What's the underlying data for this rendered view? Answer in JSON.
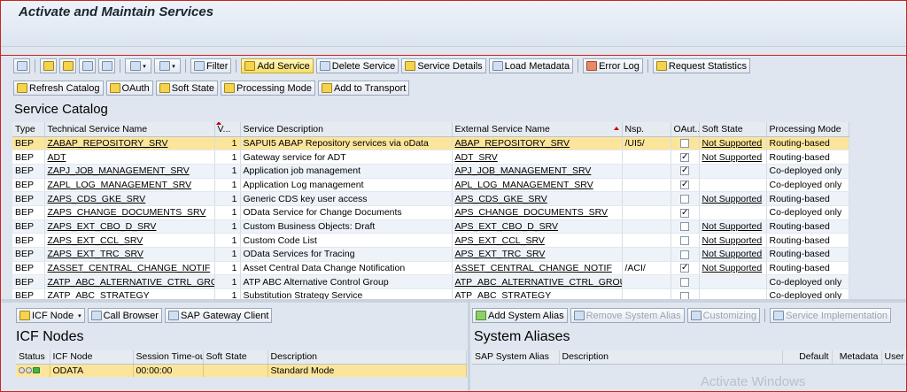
{
  "window": {
    "title": "Activate and Maintain Services"
  },
  "toolbar1": {
    "filter": "Filter",
    "add_service": "Add Service",
    "delete_service": "Delete Service",
    "service_details": "Service Details",
    "load_metadata": "Load Metadata",
    "error_log": "Error Log",
    "request_statistics": "Request Statistics"
  },
  "toolbar2": {
    "refresh_catalog": "Refresh Catalog",
    "oauth": "OAuth",
    "soft_state": "Soft State",
    "processing_mode": "Processing Mode",
    "add_to_transport": "Add to Transport"
  },
  "catalog": {
    "heading": "Service Catalog",
    "columns": [
      "Type",
      "Technical Service Name",
      "V...",
      "Service Description",
      "External Service Name",
      "Nsp.",
      "OAut...",
      "Soft State",
      "Processing Mode"
    ],
    "rows": [
      {
        "type": "BEP",
        "tech": "ZABAP_REPOSITORY_SRV",
        "ver": "1",
        "desc": "SAPUI5 ABAP Repository services via oData",
        "ext": "ABAP_REPOSITORY_SRV",
        "nsp": "/UI5/",
        "oauth": false,
        "soft": "Not Supported",
        "mode": "Routing-based"
      },
      {
        "type": "BEP",
        "tech": "ADT",
        "ver": "1",
        "desc": "Gateway service for ADT",
        "ext": "ADT_SRV",
        "nsp": "",
        "oauth": true,
        "soft": "Not Supported",
        "mode": "Routing-based"
      },
      {
        "type": "BEP",
        "tech": "ZAPJ_JOB_MANAGEMENT_SRV",
        "ver": "1",
        "desc": "Application job management",
        "ext": "APJ_JOB_MANAGEMENT_SRV",
        "nsp": "",
        "oauth": true,
        "soft": "",
        "mode": "Co-deployed only"
      },
      {
        "type": "BEP",
        "tech": "ZAPL_LOG_MANAGEMENT_SRV",
        "ver": "1",
        "desc": "Application Log management",
        "ext": "APL_LOG_MANAGEMENT_SRV",
        "nsp": "",
        "oauth": true,
        "soft": "",
        "mode": "Co-deployed only"
      },
      {
        "type": "BEP",
        "tech": "ZAPS_CDS_GKE_SRV",
        "ver": "1",
        "desc": "Generic CDS key user access",
        "ext": "APS_CDS_GKE_SRV",
        "nsp": "",
        "oauth": false,
        "soft": "Not Supported",
        "mode": "Routing-based"
      },
      {
        "type": "BEP",
        "tech": "ZAPS_CHANGE_DOCUMENTS_SRV",
        "ver": "1",
        "desc": "OData Service for Change Documents",
        "ext": "APS_CHANGE_DOCUMENTS_SRV",
        "nsp": "",
        "oauth": true,
        "soft": "",
        "mode": "Co-deployed only"
      },
      {
        "type": "BEP",
        "tech": "ZAPS_EXT_CBO_D_SRV",
        "ver": "1",
        "desc": "Custom Business Objects: Draft",
        "ext": "APS_EXT_CBO_D_SRV",
        "nsp": "",
        "oauth": false,
        "soft": "Not Supported",
        "mode": "Routing-based"
      },
      {
        "type": "BEP",
        "tech": "ZAPS_EXT_CCL_SRV",
        "ver": "1",
        "desc": "Custom Code List",
        "ext": "APS_EXT_CCL_SRV",
        "nsp": "",
        "oauth": false,
        "soft": "Not Supported",
        "mode": "Routing-based"
      },
      {
        "type": "BEP",
        "tech": "ZAPS_EXT_TRC_SRV",
        "ver": "1",
        "desc": "OData Services for Tracing",
        "ext": "APS_EXT_TRC_SRV",
        "nsp": "",
        "oauth": false,
        "soft": "Not Supported",
        "mode": "Routing-based"
      },
      {
        "type": "BEP",
        "tech": "ZASSET_CENTRAL_CHANGE_NOTIF",
        "ver": "1",
        "desc": "Asset Central Data Change Notification",
        "ext": "ASSET_CENTRAL_CHANGE_NOTIF",
        "nsp": "/ACI/",
        "oauth": true,
        "soft": "Not Supported",
        "mode": "Routing-based"
      },
      {
        "type": "BEP",
        "tech": "ZATP_ABC_ALTERNATIVE_CTRL_GROUP",
        "ver": "1",
        "desc": "ATP ABC Alternative Control Group",
        "ext": "ATP_ABC_ALTERNATIVE_CTRL_GROUP",
        "nsp": "",
        "oauth": false,
        "soft": "",
        "mode": "Co-deployed only"
      },
      {
        "type": "BEP",
        "tech": "ZATP_ABC_STRATEGY",
        "ver": "1",
        "desc": "Substitution Strategy Service",
        "ext": "ATP_ABC_STRATEGY",
        "nsp": "",
        "oauth": false,
        "soft": "",
        "mode": "Co-deployed only"
      }
    ]
  },
  "icf": {
    "icf_node_btn": "ICF Node",
    "call_browser": "Call Browser",
    "gateway_client": "SAP Gateway Client",
    "heading": "ICF Nodes",
    "columns": [
      "Status",
      "ICF Node",
      "Session Time-out",
      "Soft State",
      "Description"
    ],
    "rows": [
      {
        "node": "ODATA",
        "timeout": "00:00:00",
        "soft": "",
        "desc": "Standard Mode"
      }
    ]
  },
  "aliases": {
    "add": "Add System Alias",
    "remove": "Remove System Alias",
    "customizing": "Customizing",
    "impl": "Service Implementation",
    "heading": "System Aliases",
    "columns": [
      "SAP System Alias",
      "Description",
      "Default",
      "Metadata",
      "User"
    ]
  },
  "watermark": "Activate Windows"
}
